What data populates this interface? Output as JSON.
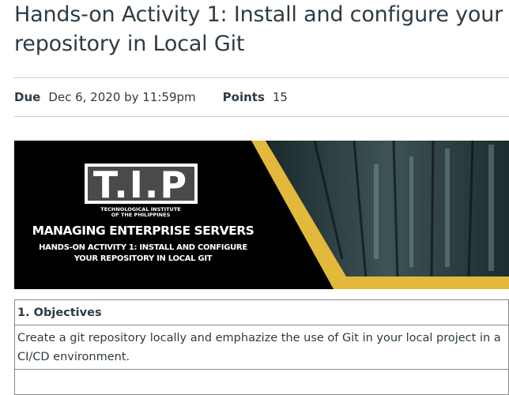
{
  "assignment": {
    "title": "Hands-on Activity 1: Install and configure your repository in Local Git",
    "due_label": "Due",
    "due_value": "Dec 6, 2020 by 11:59pm",
    "points_label": "Points",
    "points_value": "15"
  },
  "banner": {
    "logo_text": "T.I.P",
    "institute_line1": "TECHNOLOGICAL INSTITUTE",
    "institute_line2": "OF THE PHILIPPINES",
    "course_title": "MANAGING ENTERPRISE SERVERS",
    "activity_line1": "HANDS-ON ACTIVITY 1: INSTALL AND CONFIGURE",
    "activity_line2": "YOUR REPOSITORY IN LOCAL GIT",
    "accent_color": "#e2b93b"
  },
  "objectives": {
    "heading": "1. Objectives",
    "text": "Create a git repository locally and emphazize the use of Git in your local project in a CI/CD environment."
  }
}
